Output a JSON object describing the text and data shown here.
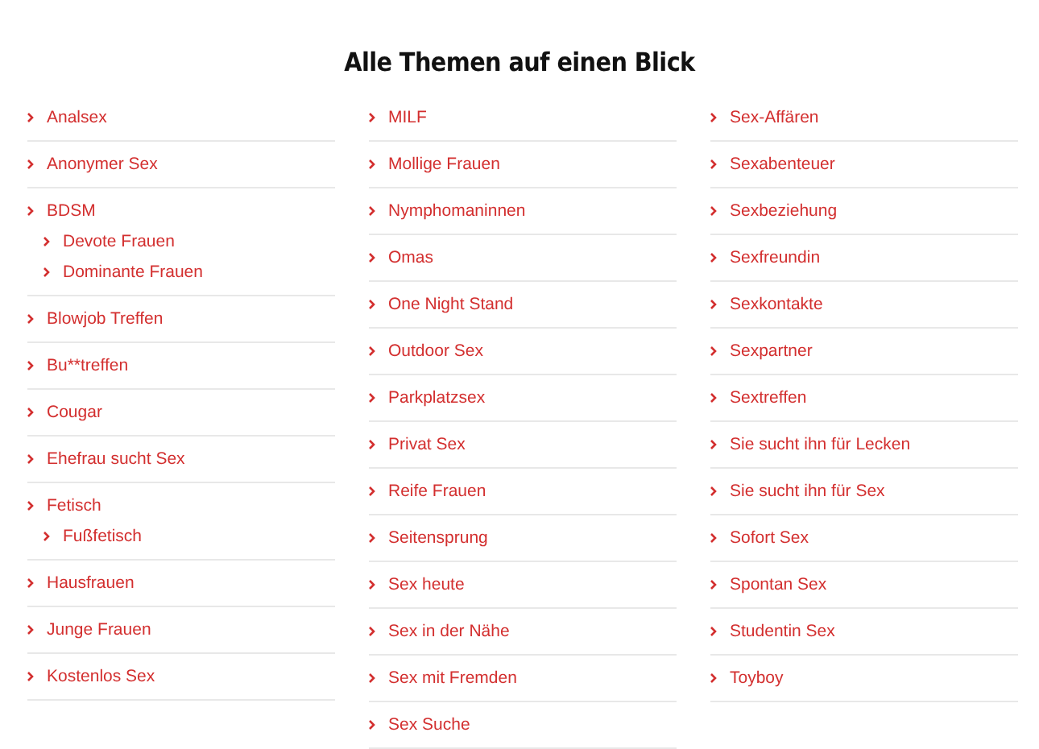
{
  "title": "Alle Themen auf einen Blick",
  "columns": [
    {
      "items": [
        {
          "label": "Analsex"
        },
        {
          "label": "Anonymer Sex"
        },
        {
          "label": "BDSM",
          "children": [
            {
              "label": "Devote Frauen"
            },
            {
              "label": "Dominante Frauen"
            }
          ]
        },
        {
          "label": "Blowjob Treffen"
        },
        {
          "label": "Bu**treffen"
        },
        {
          "label": "Cougar"
        },
        {
          "label": "Ehefrau sucht Sex"
        },
        {
          "label": "Fetisch",
          "children": [
            {
              "label": "Fußfetisch"
            }
          ]
        },
        {
          "label": "Hausfrauen"
        },
        {
          "label": "Junge Frauen"
        },
        {
          "label": "Kostenlos Sex"
        }
      ]
    },
    {
      "items": [
        {
          "label": "MILF"
        },
        {
          "label": "Mollige Frauen"
        },
        {
          "label": "Nymphomaninnen"
        },
        {
          "label": "Omas"
        },
        {
          "label": "One Night Stand"
        },
        {
          "label": "Outdoor Sex"
        },
        {
          "label": "Parkplatzsex"
        },
        {
          "label": "Privat Sex"
        },
        {
          "label": "Reife Frauen"
        },
        {
          "label": "Seitensprung"
        },
        {
          "label": "Sex heute"
        },
        {
          "label": "Sex in der Nähe"
        },
        {
          "label": "Sex mit Fremden"
        },
        {
          "label": "Sex Suche"
        }
      ]
    },
    {
      "items": [
        {
          "label": "Sex-Affären"
        },
        {
          "label": "Sexabenteuer"
        },
        {
          "label": "Sexbeziehung"
        },
        {
          "label": "Sexfreundin"
        },
        {
          "label": "Sexkontakte"
        },
        {
          "label": "Sexpartner"
        },
        {
          "label": "Sextreffen"
        },
        {
          "label": "Sie sucht ihn für Lecken"
        },
        {
          "label": "Sie sucht ihn für Sex"
        },
        {
          "label": "Sofort Sex"
        },
        {
          "label": "Spontan Sex"
        },
        {
          "label": "Studentin Sex"
        },
        {
          "label": "Toyboy"
        }
      ]
    }
  ]
}
